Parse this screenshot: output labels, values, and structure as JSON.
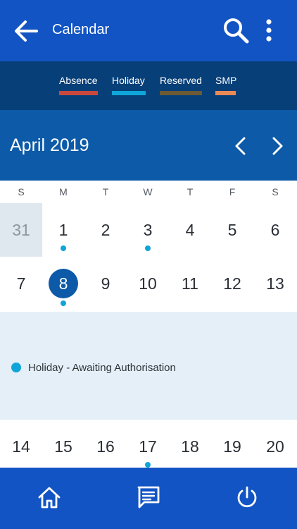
{
  "header": {
    "title": "Calendar",
    "icons": [
      "back-arrow-icon",
      "search-icon",
      "more-vertical-icon"
    ]
  },
  "legend": [
    {
      "label": "Absence",
      "color": "#c8483e"
    },
    {
      "label": "Holiday",
      "color": "#10a5d8"
    },
    {
      "label": "Reserved",
      "color": "#6b5a35"
    },
    {
      "label": "SMP",
      "color": "#ea8a55"
    }
  ],
  "calendar": {
    "month_label": "April 2019",
    "weekdays": [
      "S",
      "M",
      "T",
      "W",
      "T",
      "F",
      "S"
    ],
    "weeks": [
      [
        "31",
        "1",
        "2",
        "3",
        "4",
        "5",
        "6"
      ],
      [
        "7",
        "8",
        "9",
        "10",
        "11",
        "12",
        "13"
      ],
      [
        "14",
        "15",
        "16",
        "17",
        "18",
        "19",
        "20"
      ]
    ],
    "selected_day": "8",
    "days_with_events": [
      "1",
      "3",
      "8",
      "17"
    ]
  },
  "events": [
    {
      "text": "Holiday - Awaiting Authorisation",
      "color": "#10a5d8"
    }
  ],
  "bottom_nav": [
    "home-icon",
    "messages-icon",
    "power-icon"
  ],
  "colors": {
    "app_bar": "#1254c4",
    "legend_bg": "#073f78",
    "month_bar": "#0c5aa8",
    "event_panel": "#e4eff8"
  }
}
